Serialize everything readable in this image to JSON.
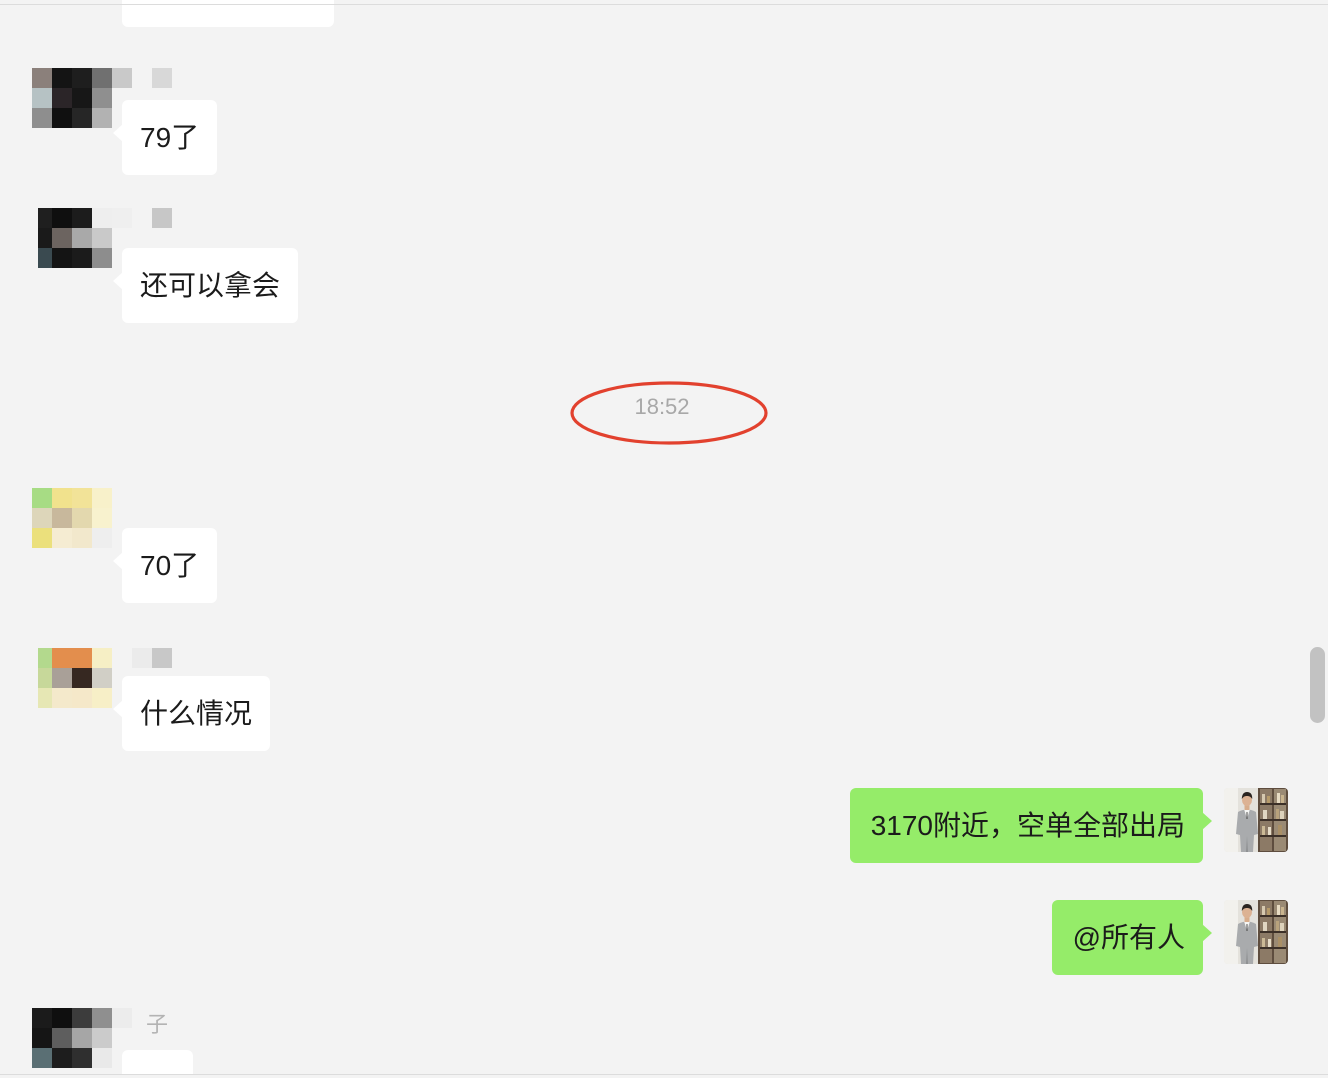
{
  "theme": {
    "chat_background": "#f3f3f3",
    "incoming_bubble": "#ffffff",
    "outgoing_bubble": "#95ec69",
    "timestamp_text": "#a8a8a8",
    "annotation_stroke": "#e2412e"
  },
  "chat": {
    "messages": [
      {
        "outgoing": false
      },
      {
        "outgoing": false,
        "avatar_pixelated": true,
        "avatar_cells": [
          [
            "#8b807b",
            "#141414",
            "#1e1e1e",
            "#707070"
          ],
          [
            "#b6c2c4",
            "#2b2528",
            "#171717",
            "#8f8f8f"
          ],
          [
            "#8e8e8e",
            "#101010",
            "#262626",
            "#b2b2b2"
          ]
        ],
        "name_cells": [
          "#c9c9c9",
          "transparent",
          "#d8d8d8"
        ],
        "text": "79了"
      },
      {
        "outgoing": false,
        "avatar_pixelated": true,
        "avatar_cells": [
          [
            "#1f1f1f",
            "#0f0f0f",
            "#1c1c1c",
            "#eeeeee"
          ],
          [
            "#1a1a1a",
            "#6c6460",
            "#a9a9a9",
            "#c9c9c9"
          ],
          [
            "#3a4a50",
            "#141414",
            "#1b1b1b",
            "#8d8d8d"
          ]
        ],
        "name_cells": [
          "#efefef",
          "transparent",
          "#c7c7c7"
        ],
        "text": "还可以拿会"
      },
      {
        "outgoing": false,
        "avatar_pixelated": true,
        "avatar_cells": [
          [
            "#a7dc84",
            "#f1e28d",
            "#f2e398",
            "#f8f1ca"
          ],
          [
            "#ddd6ba",
            "#c8b89c",
            "#e3d8ae",
            "#f8f2ce"
          ],
          [
            "#ebe07c",
            "#f5ecd2",
            "#f2e8cc",
            "#eeeeee"
          ]
        ],
        "text": "70了"
      },
      {
        "outgoing": false,
        "avatar_pixelated": true,
        "avatar_cells": [
          [
            "#b3d98d",
            "#e38e4d",
            "#e38e4d",
            "#f6efc5"
          ],
          [
            "#c7d89a",
            "#a9a098",
            "#362821",
            "#d1cfc6"
          ],
          [
            "#e6e7b4",
            "#f4e9cb",
            "#f5e8c9",
            "#f7efc7"
          ]
        ],
        "name_cells": [
          "transparent",
          "#ebebeb",
          "#c8c8c8"
        ],
        "text": "什么情况"
      },
      {
        "outgoing": true,
        "text": "3170附近，空单全部出局"
      },
      {
        "outgoing": true,
        "text": "@所有人"
      },
      {
        "outgoing": false,
        "avatar_pixelated": true,
        "avatar_cells": [
          [
            "#1b1b1b",
            "#0f0f0f",
            "#3c3c3c",
            "#8f8f8f"
          ],
          [
            "#151515",
            "#5e5e5e",
            "#a6a6a6",
            "#cbcbcb"
          ],
          [
            "#5a6f74",
            "#1d1d1d",
            "#2f2f2f",
            "#e9e9e9"
          ]
        ],
        "name_cells": [
          "#ececec"
        ],
        "sender_name": "子"
      }
    ],
    "time_divider": "18:52"
  }
}
